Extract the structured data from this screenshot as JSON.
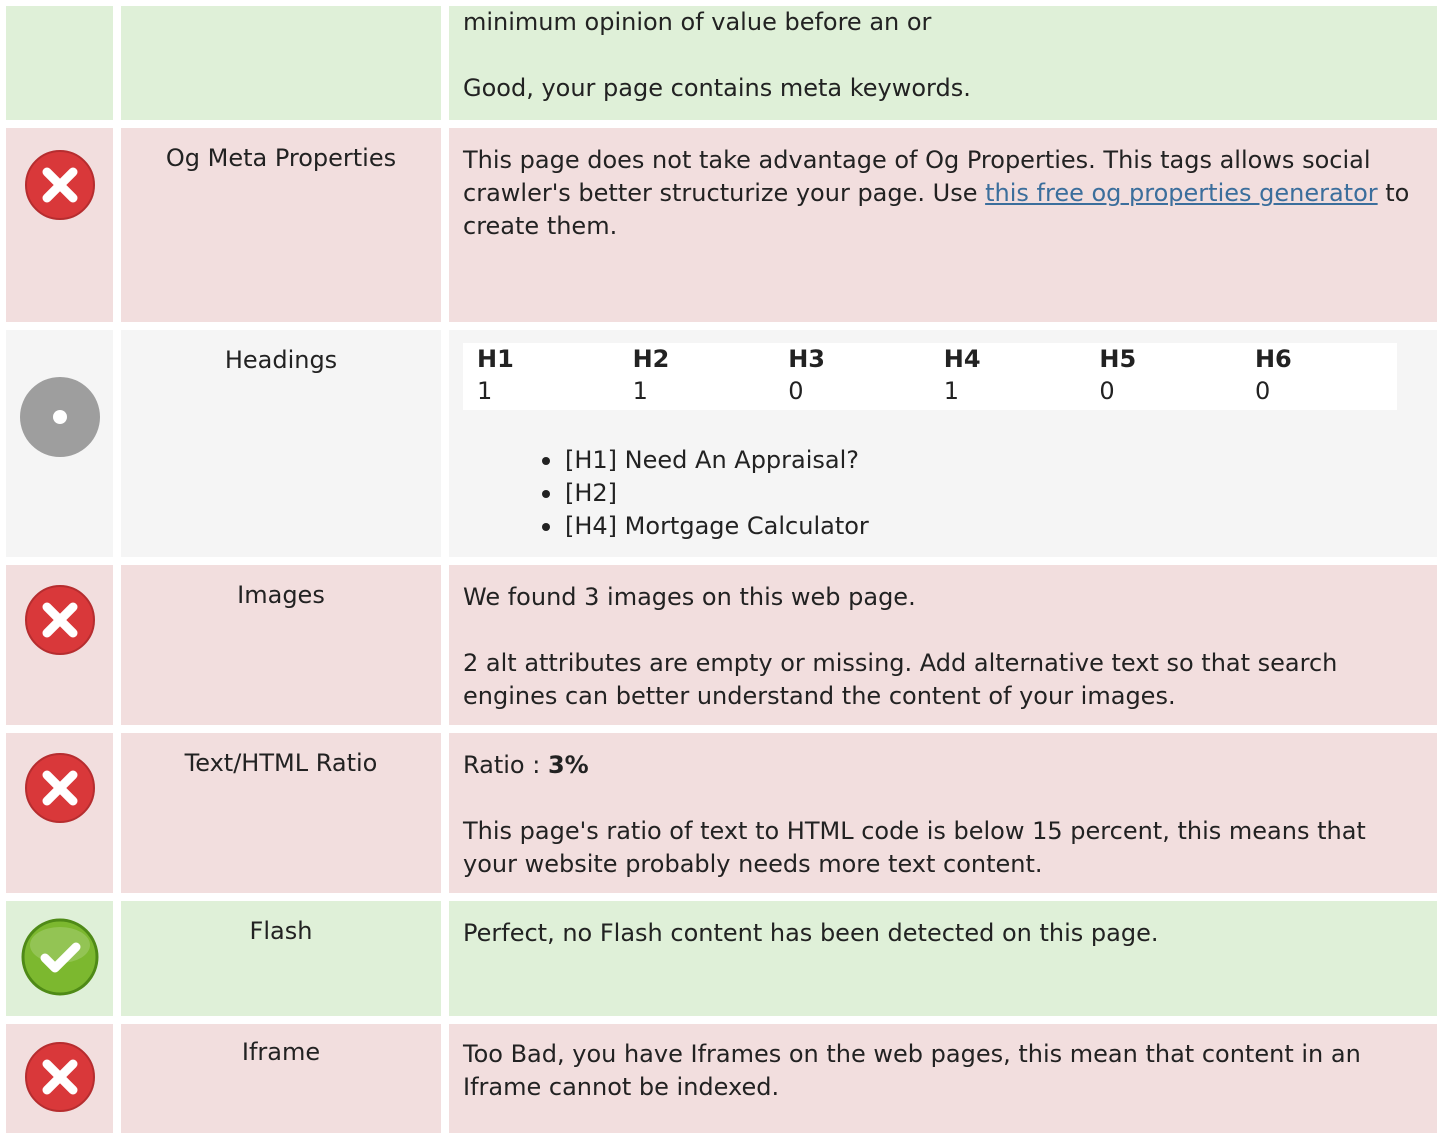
{
  "rows": {
    "keywords": {
      "content_line1": "minimum opinion of value before an or",
      "content_line2": "Good, your page contains meta keywords."
    },
    "og": {
      "status": "error",
      "label": "Og Meta Properties",
      "text_before": "This page does not take advantage of Og Properties. This tags allows social crawler's better structurize your page. Use ",
      "link_text": "this free og properties generator",
      "text_after": " to create them."
    },
    "headings": {
      "status": "neutral",
      "label": "Headings",
      "table": {
        "headers": [
          "H1",
          "H2",
          "H3",
          "H4",
          "H5",
          "H6"
        ],
        "values": [
          "1",
          "1",
          "0",
          "1",
          "0",
          "0"
        ]
      },
      "list": [
        "[H1] Need An Appraisal?",
        "[H2]",
        "[H4] Mortgage Calculator"
      ]
    },
    "images": {
      "status": "error",
      "label": "Images",
      "line1": "We found 3 images on this web page.",
      "line2": "2 alt attributes are empty or missing. Add alternative text so that search engines can better understand the content of your images."
    },
    "ratio": {
      "status": "error",
      "label": "Text/HTML Ratio",
      "ratio_label": "Ratio : ",
      "ratio_value": "3%",
      "line2": "This page's ratio of text to HTML code is below 15 percent, this means that your website probably needs more text content."
    },
    "flash": {
      "status": "success",
      "label": "Flash",
      "line1": "Perfect, no Flash content has been detected on this page."
    },
    "iframe": {
      "status": "error",
      "label": "Iframe",
      "line1": "Too Bad, you have Iframes on the web pages, this mean that content in an Iframe cannot be indexed."
    }
  },
  "colors": {
    "success_bg": "#dff0d8",
    "error_bg": "#f2dede",
    "neutral_bg": "#f5f5f5",
    "error_icon": "#d9383a",
    "success_icon": "#7cb82f",
    "neutral_icon": "#9e9e9e",
    "link": "#3b6e9c"
  },
  "icons": {
    "error": "error-x-icon",
    "success": "checkmark-icon",
    "neutral": "neutral-dot-icon"
  }
}
